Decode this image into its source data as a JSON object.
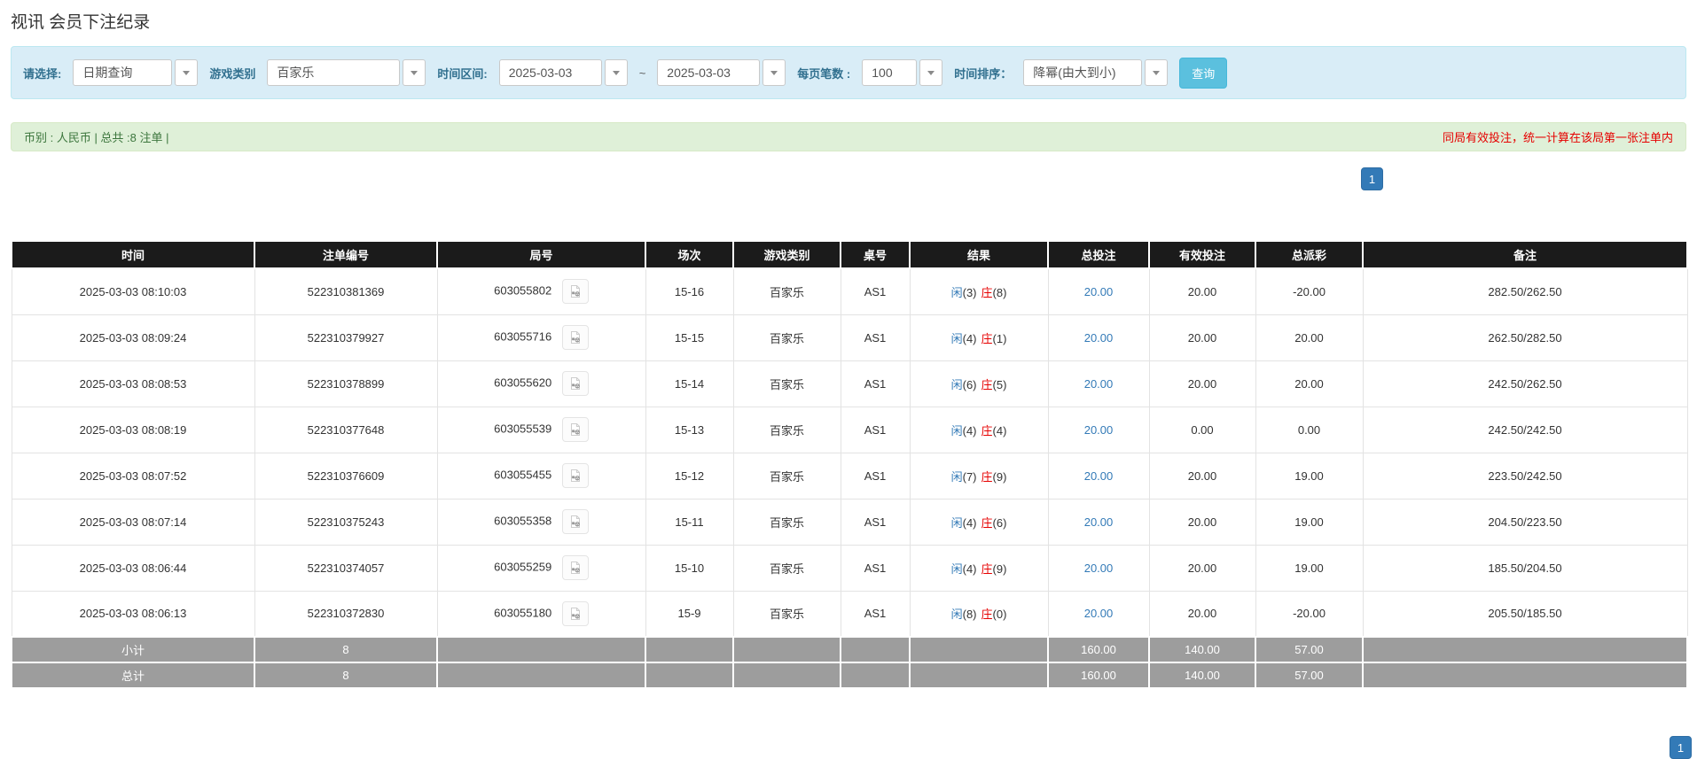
{
  "title": "视讯 会员下注纪录",
  "filter": {
    "select_label": "请选择:",
    "select_value": "日期查询",
    "game_label": "游戏类别",
    "game_value": "百家乐",
    "range_label": "时间区间:",
    "date_from": "2025-03-03",
    "tilde": "~",
    "date_to": "2025-03-03",
    "perpage_label": "每页笔数 :",
    "perpage_value": "100",
    "sort_label": "时间排序：",
    "sort_value": "降幂(由大到小)",
    "query_button": "查询"
  },
  "notice": {
    "left": "币别 : 人民币 | 总共 :8 注单 |",
    "right": "同局有效投注，统一计算在该局第一张注单内"
  },
  "pagination": {
    "current": "1"
  },
  "colors": {
    "accent_blue": "#337ab7",
    "negative_red": "#e60000",
    "query_cyan": "#5bc0de",
    "header_black": "#1b1b1b",
    "totals_gray": "#9d9d9d",
    "panel_blue": "#d9edf7",
    "notice_green": "#dff0d8"
  },
  "table": {
    "headers": [
      "时间",
      "注单编号",
      "局号",
      "场次",
      "游戏类别",
      "桌号",
      "结果",
      "总投注",
      "有效投注",
      "总派彩",
      "备注"
    ],
    "rows": [
      {
        "time": "2025-03-03 08:10:03",
        "bet_no": "522310381369",
        "round_no": "603055802",
        "session": "15-16",
        "game": "百家乐",
        "table_no": "AS1",
        "result": {
          "player_label": "闲",
          "player_score": "(3)",
          "banker_label": "庄",
          "banker_score": "(8)"
        },
        "total_bet": "20.00",
        "valid_bet": "20.00",
        "payout": "-20.00",
        "remark": "282.50/262.50"
      },
      {
        "time": "2025-03-03 08:09:24",
        "bet_no": "522310379927",
        "round_no": "603055716",
        "session": "15-15",
        "game": "百家乐",
        "table_no": "AS1",
        "result": {
          "player_label": "闲",
          "player_score": "(4)",
          "banker_label": "庄",
          "banker_score": "(1)"
        },
        "total_bet": "20.00",
        "valid_bet": "20.00",
        "payout": "20.00",
        "remark": "262.50/282.50"
      },
      {
        "time": "2025-03-03 08:08:53",
        "bet_no": "522310378899",
        "round_no": "603055620",
        "session": "15-14",
        "game": "百家乐",
        "table_no": "AS1",
        "result": {
          "player_label": "闲",
          "player_score": "(6)",
          "banker_label": "庄",
          "banker_score": "(5)"
        },
        "total_bet": "20.00",
        "valid_bet": "20.00",
        "payout": "20.00",
        "remark": "242.50/262.50"
      },
      {
        "time": "2025-03-03 08:08:19",
        "bet_no": "522310377648",
        "round_no": "603055539",
        "session": "15-13",
        "game": "百家乐",
        "table_no": "AS1",
        "result": {
          "player_label": "闲",
          "player_score": "(4)",
          "banker_label": "庄",
          "banker_score": "(4)"
        },
        "total_bet": "20.00",
        "valid_bet": "0.00",
        "payout": "0.00",
        "remark": "242.50/242.50"
      },
      {
        "time": "2025-03-03 08:07:52",
        "bet_no": "522310376609",
        "round_no": "603055455",
        "session": "15-12",
        "game": "百家乐",
        "table_no": "AS1",
        "result": {
          "player_label": "闲",
          "player_score": "(7)",
          "banker_label": "庄",
          "banker_score": "(9)"
        },
        "total_bet": "20.00",
        "valid_bet": "20.00",
        "payout": "19.00",
        "remark": "223.50/242.50"
      },
      {
        "time": "2025-03-03 08:07:14",
        "bet_no": "522310375243",
        "round_no": "603055358",
        "session": "15-11",
        "game": "百家乐",
        "table_no": "AS1",
        "result": {
          "player_label": "闲",
          "player_score": "(4)",
          "banker_label": "庄",
          "banker_score": "(6)"
        },
        "total_bet": "20.00",
        "valid_bet": "20.00",
        "payout": "19.00",
        "remark": "204.50/223.50"
      },
      {
        "time": "2025-03-03 08:06:44",
        "bet_no": "522310374057",
        "round_no": "603055259",
        "session": "15-10",
        "game": "百家乐",
        "table_no": "AS1",
        "result": {
          "player_label": "闲",
          "player_score": "(4)",
          "banker_label": "庄",
          "banker_score": "(9)"
        },
        "total_bet": "20.00",
        "valid_bet": "20.00",
        "payout": "19.00",
        "remark": "185.50/204.50"
      },
      {
        "time": "2025-03-03 08:06:13",
        "bet_no": "522310372830",
        "round_no": "603055180",
        "session": "15-9",
        "game": "百家乐",
        "table_no": "AS1",
        "result": {
          "player_label": "闲",
          "player_score": "(8)",
          "banker_label": "庄",
          "banker_score": "(0)"
        },
        "total_bet": "20.00",
        "valid_bet": "20.00",
        "payout": "-20.00",
        "remark": "205.50/185.50"
      }
    ],
    "subtotal": {
      "label": "小计",
      "count": "8",
      "total_bet": "160.00",
      "valid_bet": "140.00",
      "payout": "57.00"
    },
    "grand_total": {
      "label": "总计",
      "count": "8",
      "total_bet": "160.00",
      "valid_bet": "140.00",
      "payout": "57.00"
    }
  }
}
